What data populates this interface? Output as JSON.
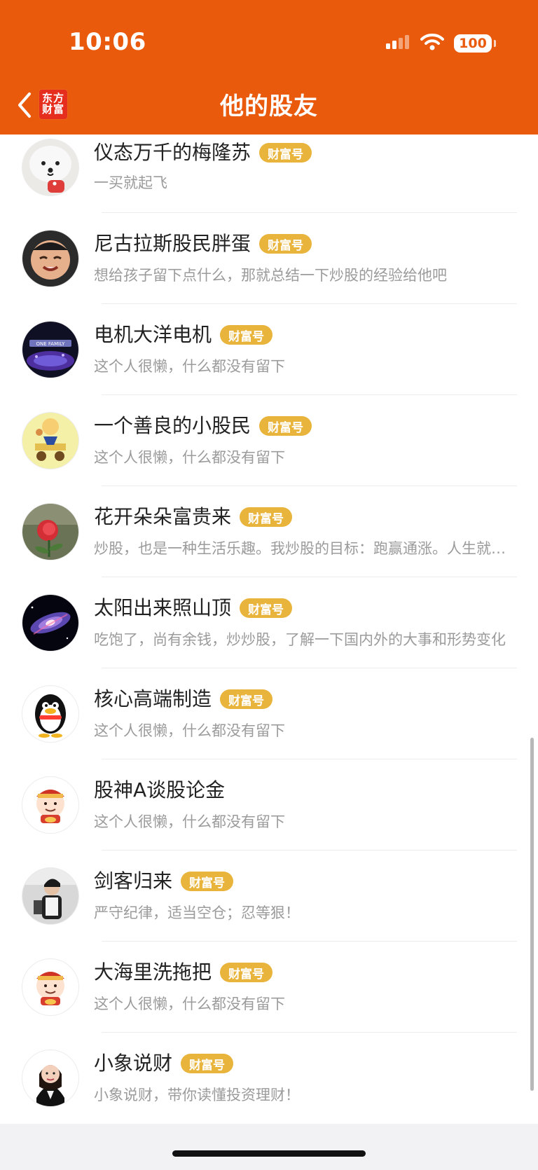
{
  "status": {
    "time": "10:06",
    "battery": "100"
  },
  "header": {
    "brand_line1": "东方",
    "brand_line2": "财富",
    "title": "他的股友"
  },
  "colors": {
    "header_bg": "#ea5a0c",
    "badge_bg": "#e9b43c",
    "brand_bg": "#e62e1f"
  },
  "friends": [
    {
      "name": "仪态万千的梅隆苏",
      "badge": "财富号",
      "description": "一买就起飞",
      "avatar": "white-dog-avatar"
    },
    {
      "name": "尼古拉斯股民胖蛋",
      "badge": "财富号",
      "description": "想给孩子留下点什么，那就总结一下炒股的经验给他吧",
      "avatar": "child-face-avatar"
    },
    {
      "name": "电机大洋电机",
      "badge": "财富号",
      "description": "这个人很懒，什么都没有留下",
      "avatar": "one-family-avatar"
    },
    {
      "name": "一个善良的小股民",
      "badge": "财富号",
      "description": "这个人很懒，什么都没有留下",
      "avatar": "cartoon-rider-avatar"
    },
    {
      "name": "花开朵朵富贵来",
      "badge": "财富号",
      "description": "炒股，也是一种生活乐趣。我炒股的目标：跑赢通涨。人生就是一场投资",
      "avatar": "rose-avatar"
    },
    {
      "name": "太阳出来照山顶",
      "badge": "财富号",
      "description": "吃饱了，尚有余钱，炒炒股，了解一下国内外的大事和形势变化",
      "avatar": "galaxy-avatar"
    },
    {
      "name": "核心高端制造",
      "badge": "财富号",
      "description": "这个人很懒，什么都没有留下",
      "avatar": "penguin-avatar"
    },
    {
      "name": "股神A谈股论金",
      "badge": "",
      "description": "这个人很懒，什么都没有留下",
      "avatar": "wealth-god-avatar"
    },
    {
      "name": "剑客归来",
      "badge": "财富号",
      "description": "严守纪律，适当空仓；忍等狠！",
      "avatar": "man-photo-avatar"
    },
    {
      "name": "大海里洗拖把",
      "badge": "财富号",
      "description": "这个人很懒，什么都没有留下",
      "avatar": "wealth-god-avatar"
    },
    {
      "name": "小象说财",
      "badge": "财富号",
      "description": "小象说财，带你读懂投资理财！",
      "avatar": "woman-avatar"
    }
  ]
}
